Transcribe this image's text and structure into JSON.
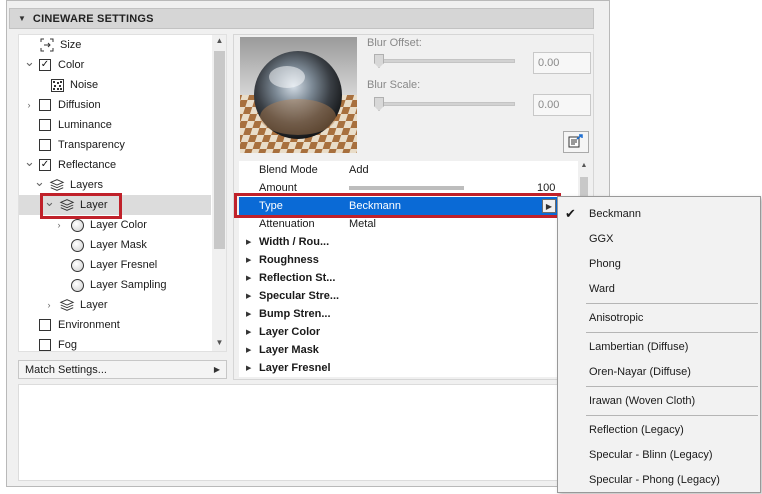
{
  "panel": {
    "title": "CINEWARE SETTINGS"
  },
  "tree": {
    "items": [
      {
        "label": "Size",
        "indent": 0,
        "chevron": "",
        "control": "size-icon"
      },
      {
        "label": "Color",
        "indent": 0,
        "chevron": "expanded",
        "control": "checkbox-checked"
      },
      {
        "label": "Noise",
        "indent": 1,
        "chevron": "",
        "control": "noise-icon"
      },
      {
        "label": "Diffusion",
        "indent": 0,
        "chevron": "collapsed",
        "control": "checkbox"
      },
      {
        "label": "Luminance",
        "indent": 0,
        "chevron": "",
        "control": "checkbox"
      },
      {
        "label": "Transparency",
        "indent": 0,
        "chevron": "",
        "control": "checkbox"
      },
      {
        "label": "Reflectance",
        "indent": 0,
        "chevron": "expanded",
        "control": "checkbox-checked"
      },
      {
        "label": "Layers",
        "indent": 1,
        "chevron": "expanded",
        "control": "layers-icon"
      },
      {
        "label": "Layer",
        "indent": 2,
        "chevron": "expanded",
        "control": "layers-icon",
        "selected": true
      },
      {
        "label": "Layer Color",
        "indent": 3,
        "chevron": "collapsed",
        "control": "circle"
      },
      {
        "label": "Layer Mask",
        "indent": 3,
        "chevron": "",
        "control": "circle"
      },
      {
        "label": "Layer Fresnel",
        "indent": 3,
        "chevron": "",
        "control": "circle"
      },
      {
        "label": "Layer Sampling",
        "indent": 3,
        "chevron": "",
        "control": "circle"
      },
      {
        "label": "Layer",
        "indent": 2,
        "chevron": "collapsed",
        "control": "layers-icon"
      },
      {
        "label": "Environment",
        "indent": 0,
        "chevron": "",
        "control": "checkbox"
      },
      {
        "label": "Fog",
        "indent": 0,
        "chevron": "",
        "control": "checkbox"
      }
    ]
  },
  "match_settings": {
    "label": "Match Settings..."
  },
  "blur": {
    "offset_label": "Blur Offset:",
    "offset_value": "0.00",
    "scale_label": "Blur Scale:",
    "scale_value": "0.00"
  },
  "properties": {
    "rows": [
      {
        "name": "Blend Mode",
        "value": "Add",
        "kind": "plain"
      },
      {
        "name": "Amount",
        "value": "100",
        "kind": "amount",
        "level": 1.0
      },
      {
        "name": "Type",
        "value": "Beckmann",
        "kind": "selected"
      },
      {
        "name": "Attenuation",
        "value": "Metal",
        "kind": "plain"
      },
      {
        "name": "Width / Rou...",
        "value": "",
        "kind": "group"
      },
      {
        "name": "Roughness",
        "value": "",
        "kind": "group"
      },
      {
        "name": "Reflection St...",
        "value": "",
        "kind": "group"
      },
      {
        "name": "Specular Stre...",
        "value": "",
        "kind": "group"
      },
      {
        "name": "Bump Stren...",
        "value": "",
        "kind": "group"
      },
      {
        "name": "Layer Color",
        "value": "",
        "kind": "group"
      },
      {
        "name": "Layer Mask",
        "value": "",
        "kind": "group"
      },
      {
        "name": "Layer Fresnel",
        "value": "",
        "kind": "group"
      }
    ]
  },
  "type_menu": {
    "selected": "Beckmann",
    "items": [
      {
        "label": "Beckmann",
        "checked": true
      },
      {
        "label": "GGX"
      },
      {
        "label": "Phong"
      },
      {
        "label": "Ward"
      },
      {
        "separator": true
      },
      {
        "label": "Anisotropic"
      },
      {
        "separator": true
      },
      {
        "label": "Lambertian (Diffuse)"
      },
      {
        "label": "Oren-Nayar (Diffuse)"
      },
      {
        "separator": true
      },
      {
        "label": "Irawan (Woven Cloth)"
      },
      {
        "separator": true
      },
      {
        "label": "Reflection (Legacy)"
      },
      {
        "label": "Specular - Blinn (Legacy)"
      },
      {
        "label": "Specular - Phong (Legacy)"
      }
    ]
  },
  "colors": {
    "selection_blue": "#0a6ad6",
    "highlight_red": "#c0212a"
  }
}
